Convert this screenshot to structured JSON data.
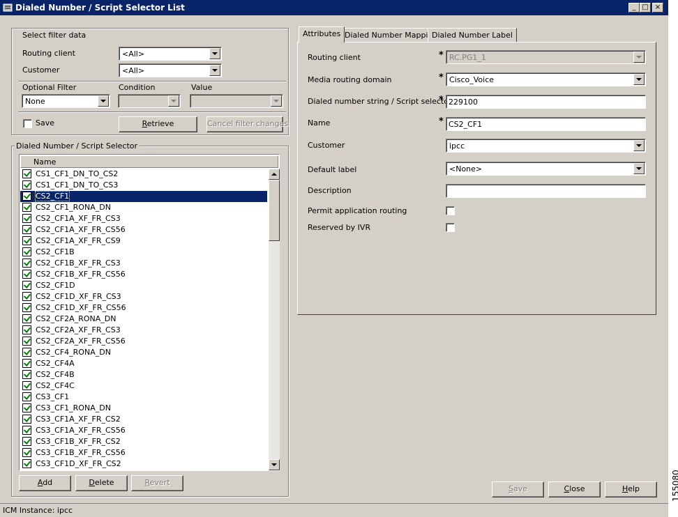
{
  "window": {
    "title": "Dialed Number / Script Selector List",
    "controls": [
      "_",
      "□",
      "×"
    ]
  },
  "filter": {
    "group_label": "Select filter data",
    "routing_client_label": "Routing client",
    "routing_client_value": "<All>",
    "customer_label": "Customer",
    "customer_value": "<All>",
    "optional_filter_label": "Optional Filter",
    "condition_label": "Condition",
    "value_label": "Value",
    "optional_filter_value": "None",
    "save_label": "Save",
    "retrieve_label": "Retrieve",
    "retrieve_mnemonic": "R",
    "retrieve_rest": "etrieve",
    "cancel_filter_label": "Cancel filter changes"
  },
  "list": {
    "group_label": "Dialed Number / Script Selector",
    "column_header": "Name",
    "selected_index": 2,
    "items": [
      "CS1_CF1_DN_TO_CS2",
      "CS1_CF1_DN_TO_CS3",
      "CS2_CF1",
      "CS2_CF1_RONA_DN",
      "CS2_CF1A_XF_FR_CS3",
      "CS2_CF1A_XF_FR_CS56",
      "CS2_CF1A_XF_FR_CS9",
      "CS2_CF1B",
      "CS2_CF1B_XF_FR_CS3",
      "CS2_CF1B_XF_FR_CS56",
      "CS2_CF1D",
      "CS2_CF1D_XF_FR_CS3",
      "CS2_CF1D_XF_FR_CS56",
      "CS2_CF2A_RONA_DN",
      "CS2_CF2A_XF_FR_CS3",
      "CS2_CF2A_XF_FR_CS56",
      "CS2_CF4_RONA_DN",
      "CS2_CF4A",
      "CS2_CF4B",
      "CS2_CF4C",
      "CS3_CF1",
      "CS3_CF1_RONA_DN",
      "CS3_CF1A_XF_FR_CS2",
      "CS3_CF1A_XF_FR_CS56",
      "CS3_CF1B_XF_FR_CS2",
      "CS3_CF1B_XF_FR_CS56",
      "CS3_CF1D_XF_FR_CS2"
    ],
    "add_mnemonic": "A",
    "add_rest": "dd",
    "delete_mnemonic": "D",
    "delete_rest": "elete",
    "revert_mnemonic": "R",
    "revert_rest": "evert"
  },
  "tabs": [
    "Attributes",
    "Dialed Number Mapping",
    "Dialed Number Label"
  ],
  "attributes": {
    "routing_client_label": "Routing client",
    "routing_client_value": "RC.PG1_1",
    "media_routing_domain_label": "Media routing domain",
    "media_routing_domain_value": "Cisco_Voice",
    "dialed_number_label": "Dialed number string / Script selector",
    "dialed_number_value": "229100",
    "name_label": "Name",
    "name_value": "CS2_CF1",
    "customer_label": "Customer",
    "customer_value": "ipcc",
    "default_label_label": "Default label",
    "default_label_value": "<None>",
    "description_label": "Description",
    "description_value": "",
    "permit_routing_label": "Permit application routing",
    "reserved_ivr_label": "Reserved by IVR",
    "required_marker": "*"
  },
  "bottom_buttons": {
    "save_mnemonic": "S",
    "save_rest": "ave",
    "close_mnemonic": "C",
    "close_rest": "lose",
    "help_mnemonic": "H",
    "help_rest": "elp"
  },
  "status": {
    "text": "ICM Instance: ipcc"
  },
  "side_id": "155080"
}
